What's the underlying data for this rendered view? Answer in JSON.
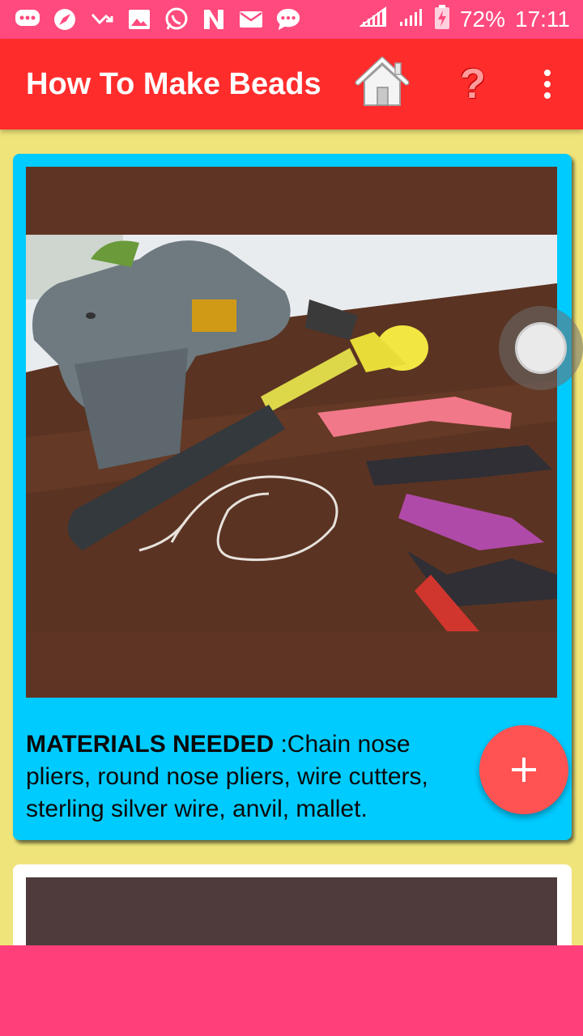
{
  "status_bar": {
    "battery": "72%",
    "time": "17:11",
    "icons": [
      "chat-icon",
      "browser-icon",
      "missed-call-icon",
      "gallery-icon",
      "whatsapp-icon",
      "n-app-icon",
      "mail-icon",
      "message-icon",
      "signal-icon",
      "signal-icon",
      "battery-charging-icon"
    ]
  },
  "app_bar": {
    "title": "How To Make Beads",
    "help_symbol": "?"
  },
  "cards": [
    {
      "heading": "MATERIALS NEEDED",
      "body": " :Chain nose pliers, round nose pliers, wire cutters, sterling silver wire, anvil, mallet."
    }
  ],
  "fab": {
    "symbol": "+"
  },
  "colors": {
    "status_bar": "#ff4a7e",
    "app_bar": "#ff2c2c",
    "background": "#efe47a",
    "card": "#00cbff",
    "fab": "#ff5252",
    "bottom_bar": "#ff3f7a"
  }
}
